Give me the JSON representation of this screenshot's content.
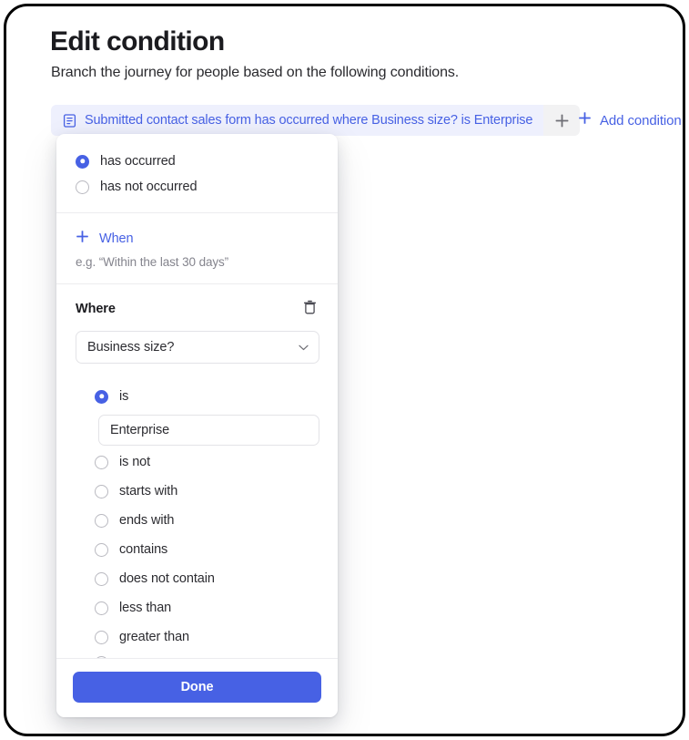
{
  "header": {
    "title": "Edit condition",
    "subtitle": "Branch the journey for people based on the following conditions."
  },
  "condition_bar": {
    "chip": {
      "icon": "form-icon",
      "label": "Submitted contact sales form has occurred where Business size? is Enterprise"
    },
    "add_chip_icon": "plus-icon",
    "add_condition": {
      "icon": "plus-icon",
      "label": "Add condition"
    }
  },
  "panel": {
    "occurrence": {
      "options": [
        {
          "label": "has occurred",
          "selected": true
        },
        {
          "label": "has not occurred",
          "selected": false
        }
      ]
    },
    "when": {
      "icon": "plus-icon",
      "label": "When",
      "hint": "e.g. “Within the last 30 days”"
    },
    "where": {
      "title": "Where",
      "delete_icon": "trash-icon",
      "attribute_select": {
        "value": "Business size?",
        "chevron_icon": "chevron-down-icon"
      },
      "operators": [
        {
          "label": "is",
          "selected": true
        },
        {
          "label": "is not",
          "selected": false
        },
        {
          "label": "starts with",
          "selected": false
        },
        {
          "label": "ends with",
          "selected": false
        },
        {
          "label": "contains",
          "selected": false
        },
        {
          "label": "does not contain",
          "selected": false
        },
        {
          "label": "less than",
          "selected": false
        },
        {
          "label": "greater than",
          "selected": false
        }
      ],
      "value_input": {
        "value": "Enterprise",
        "placeholder": "Enterprise"
      }
    },
    "footer": {
      "done_label": "Done"
    }
  },
  "colors": {
    "accent": "#4761e4",
    "chip_bg": "#eef0fd",
    "chip_plus_bg": "#f2f2f3",
    "text": "#2c2c31",
    "muted": "#84848d",
    "border": "#e3e3e7"
  }
}
